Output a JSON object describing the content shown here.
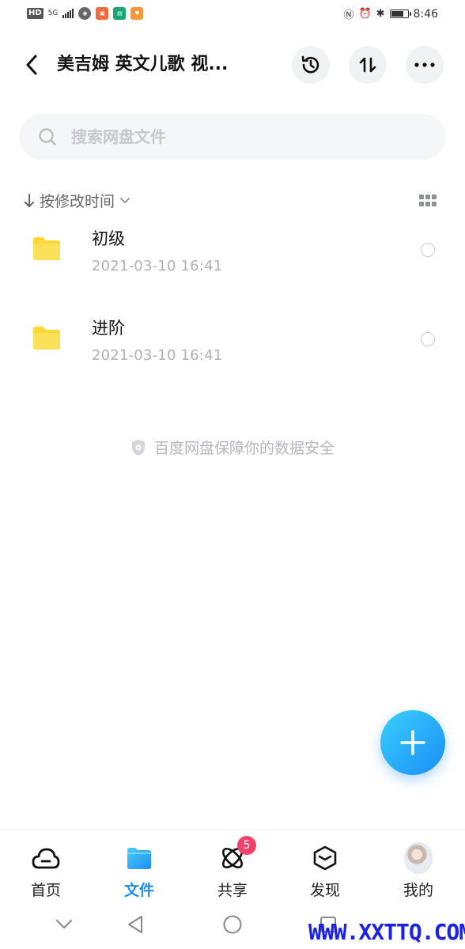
{
  "status_bar": {
    "left_badges": [
      "HD",
      "5G"
    ],
    "time": "8:46",
    "battery_level": 0.7
  },
  "header": {
    "title": "美吉姆 英文儿歌 视...",
    "buttons": [
      "back-icon",
      "history-icon",
      "sort-transfer-icon",
      "more-icon"
    ]
  },
  "search": {
    "placeholder": "搜索网盘文件"
  },
  "sort": {
    "label": "按修改时间"
  },
  "files": [
    {
      "name": "初级",
      "date": "2021-03-10  16:41"
    },
    {
      "name": "进阶",
      "date": "2021-03-10  16:41"
    }
  ],
  "safety_note": "百度网盘保障你的数据安全",
  "bottom_nav": [
    {
      "label": "首页",
      "icon": "cloud-home-icon"
    },
    {
      "label": "文件",
      "icon": "folder-icon",
      "active": true
    },
    {
      "label": "共享",
      "icon": "atom-share-icon",
      "badge": "5"
    },
    {
      "label": "发现",
      "icon": "cube-discover-icon"
    },
    {
      "label": "我的",
      "icon": "avatar"
    }
  ],
  "watermark": "WWW.XXTTQ.COM",
  "colors": {
    "accent": "#1d8ff2",
    "folder": "#fdd835",
    "badge": "#f0426b"
  }
}
